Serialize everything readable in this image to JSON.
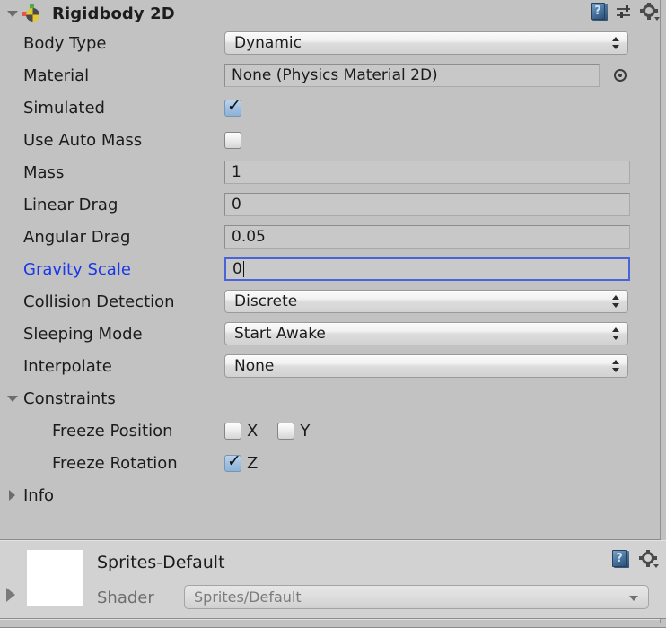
{
  "component": {
    "title": "Rigidbody 2D",
    "icon": "rigidbody-2d-icon",
    "expanded": true,
    "header_icons": [
      "help-icon",
      "preset-icon",
      "gear-icon"
    ]
  },
  "properties": [
    {
      "label": "Body Type",
      "type": "popup",
      "value": "Dynamic"
    },
    {
      "label": "Material",
      "type": "object",
      "value": "None (Physics Material 2D)"
    },
    {
      "label": "Simulated",
      "type": "checkbox",
      "value": true
    },
    {
      "label": "Use Auto Mass",
      "type": "checkbox",
      "value": false
    },
    {
      "label": "Mass",
      "type": "number",
      "value": "1"
    },
    {
      "label": "Linear Drag",
      "type": "number",
      "value": "0"
    },
    {
      "label": "Angular Drag",
      "type": "number",
      "value": "0.05"
    },
    {
      "label": "Gravity Scale",
      "type": "number",
      "value": "0",
      "focused": true,
      "modified": true
    },
    {
      "label": "Collision Detection",
      "type": "popup",
      "value": "Discrete"
    },
    {
      "label": "Sleeping Mode",
      "type": "popup",
      "value": "Start Awake"
    },
    {
      "label": "Interpolate",
      "type": "popup",
      "value": "None"
    }
  ],
  "constraints": {
    "title": "Constraints",
    "expanded": true,
    "freeze_position": {
      "label": "Freeze Position",
      "axes": [
        {
          "axis": "X",
          "checked": false
        },
        {
          "axis": "Y",
          "checked": false
        }
      ]
    },
    "freeze_rotation": {
      "label": "Freeze Rotation",
      "axes": [
        {
          "axis": "Z",
          "checked": true
        }
      ]
    }
  },
  "info": {
    "title": "Info",
    "expanded": false
  },
  "material": {
    "name": "Sprites-Default",
    "shader_label": "Shader",
    "shader_value": "Sprites/Default",
    "expanded": false,
    "header_icons": [
      "help-icon",
      "gear-icon"
    ]
  },
  "colors": {
    "background": "#c2c2c2",
    "field": "#c8c8c8",
    "modified_label": "#1a39e6",
    "focus_border": "#4a63d8",
    "checkbox_checked": "#9dbee0",
    "material_panel": "#d2d2d2"
  }
}
